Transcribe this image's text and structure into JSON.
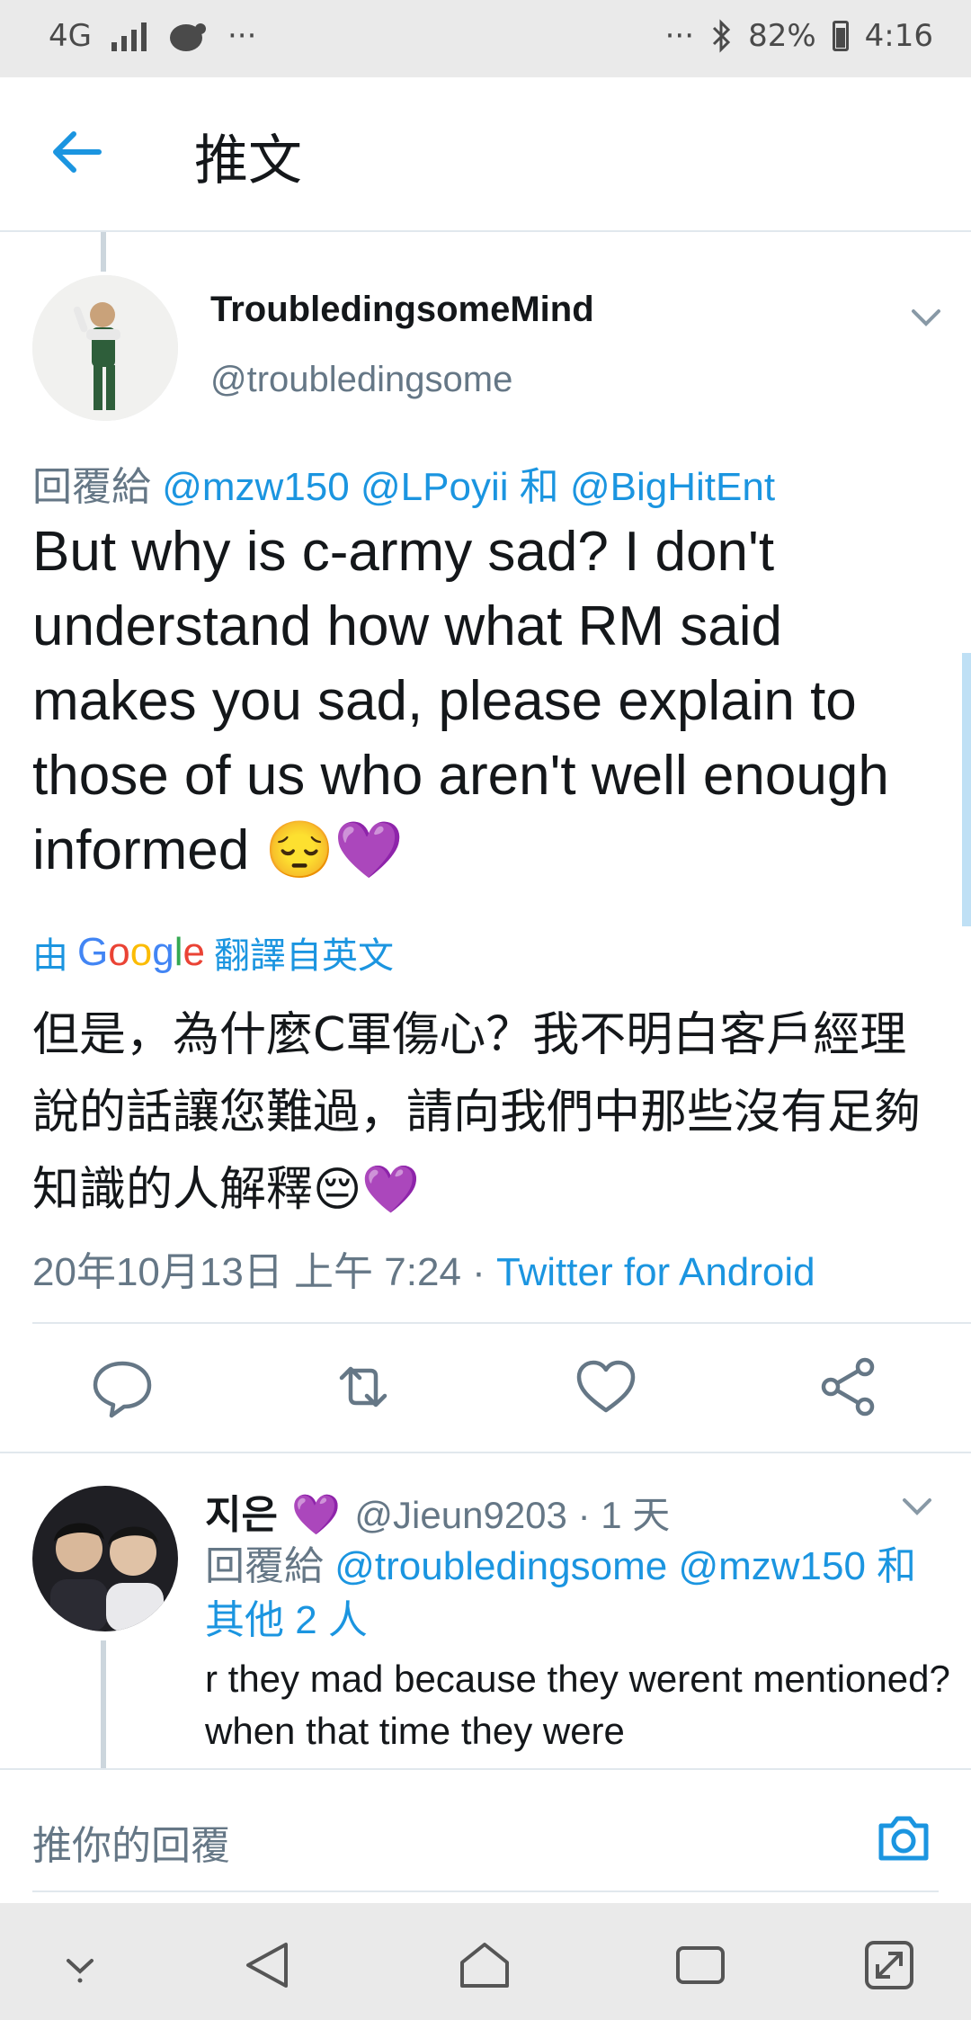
{
  "status_bar": {
    "network": "4G",
    "dots_left": "···",
    "dots_right": "···",
    "battery": "82%",
    "time": "4:16"
  },
  "header": {
    "title": "推文"
  },
  "tweet": {
    "name": "TroubledingsomeMind",
    "handle": "@troubledingsome",
    "reply_prefix": "回覆給",
    "reply_mentions": [
      "@mzw150",
      "@LPoyii",
      "@BigHitEnt"
    ],
    "reply_conjunction": "和",
    "body": "But why is c-army sad? I don't understand how what RM said makes you sad, please explain to those of us who aren't well enough informed 😔💜",
    "translated_by_prefix": "由",
    "translated_by_brand": "Google",
    "translated_by_suffix": "翻譯自英文",
    "translation": "但是，為什麼C軍傷心？我不明白客戶經理說的話讓您難過，請向我們中那些沒有足夠知識的人解釋😔💜",
    "timestamp": "20年10月13日 上午 7:24",
    "separator": "·",
    "source": "Twitter for Android"
  },
  "actions": [
    {
      "name": "reply-icon"
    },
    {
      "name": "retweet-icon"
    },
    {
      "name": "like-icon"
    },
    {
      "name": "share-icon"
    }
  ],
  "reply": {
    "name": "지은",
    "name_emoji": "💜",
    "handle": "@Jieun9203",
    "separator": "·",
    "time": "1 天",
    "reply_prefix": "回覆給",
    "reply_mentions": "@troubledingsome @mzw150 和 其他 2 人",
    "body": "r they mad because they werent mentioned?when that time they were"
  },
  "compose": {
    "placeholder": "推你的回覆"
  },
  "colors": {
    "accent": "#1b95e0",
    "secondary_text": "#657786",
    "border": "#e1e8ed"
  }
}
